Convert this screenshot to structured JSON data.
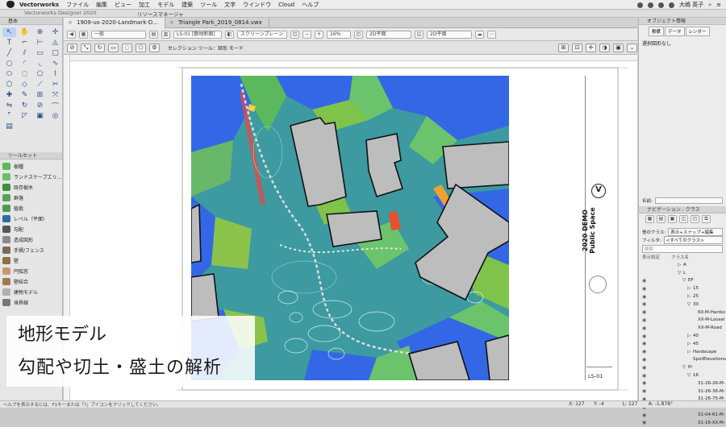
{
  "menubar": {
    "app": "Vectorworks",
    "items": [
      "ファイル",
      "編集",
      "ビュー",
      "加工",
      "モデル",
      "建築",
      "ツール",
      "文字",
      "ウインドウ",
      "Cloud",
      "ヘルプ"
    ],
    "user": "大嶋 英子"
  },
  "titlestrip": {
    "app_title": "Vectorworks Designer 2020",
    "resource_manager": "リソースマネージャ"
  },
  "left_palette": {
    "basic_title": "基本",
    "toolsets_title": "ツールセット",
    "toolsets": [
      {
        "label": "樹種",
        "color": "#5cb85c"
      },
      {
        "label": "ランドスケープエリ…",
        "color": "#6abf69"
      },
      {
        "label": "既存樹木",
        "color": "#3f8f3f"
      },
      {
        "label": "群落",
        "color": "#5aa05a"
      },
      {
        "label": "植栽",
        "color": "#4c9a4c"
      },
      {
        "label": "レベル（平面）",
        "color": "#2e6da4"
      },
      {
        "label": "勾配",
        "color": "#555555"
      },
      {
        "label": "造成図形",
        "color": "#8a8a8a"
      },
      {
        "label": "手摺/フェンス",
        "color": "#7a6a5a"
      },
      {
        "label": "壁",
        "color": "#8b6f47"
      },
      {
        "label": "円弧窓",
        "color": "#c49a6c"
      },
      {
        "label": "壁結合",
        "color": "#a07a50"
      },
      {
        "label": "建物モデル",
        "color": "#b0b0b0"
      },
      {
        "label": "境界線",
        "color": "#777777"
      }
    ]
  },
  "tabs": [
    {
      "label": "1909-us-2020-Landmark-D..."
    },
    {
      "label": "Triangle Park_2019_0814.vwx"
    }
  ],
  "viewbar": {
    "class": "一般",
    "layer": "LS-01 [敷地断面]",
    "render": "スクリーンプレーン",
    "zoom": "16%",
    "view1": "2D平面",
    "view2": "2D平面"
  },
  "modebar": {
    "label": "セレクション ツール：矩形 モード"
  },
  "titleblock": {
    "line1": "2020 DEMO",
    "line2": "Public Space",
    "sheet": "LS-01",
    "logo": "V"
  },
  "caption": {
    "line1": "地形モデル",
    "line2": "勾配や切土・盛土の解析"
  },
  "status": {
    "help": "ヘルプを表示するには、F1キーまたは「?」アイコンをクリックしてください。",
    "x_label": "X:",
    "x_value": "127",
    "y_label": "Y:",
    "y_value": "-4",
    "l_label": "L:",
    "l_value": "127",
    "a_label": "A:",
    "a_value": "-1.878°"
  },
  "right_panel": {
    "obj_info_title": "オブジェクト情報",
    "obj_tabs": [
      "形状",
      "データ",
      "レンダー"
    ],
    "no_selection": "選択図形なし",
    "name_label": "名前:",
    "nav_title": "ナビゲーション - クラス",
    "other_classes_label": "他のクラス:",
    "other_classes_value": "表示+スナップ+編集",
    "filter_label": "フィルタ:",
    "filter_value": "<すべてのクラス>",
    "search_placeholder": "検索",
    "col_visibility": "表示設定",
    "col_class": "クラス名",
    "classes": [
      {
        "label": "A",
        "indent": 1,
        "arrow": "▷"
      },
      {
        "label": "L",
        "indent": 1,
        "arrow": "▽"
      },
      {
        "label": "EF",
        "indent": 2,
        "arrow": "▽"
      },
      {
        "label": "15",
        "indent": 3,
        "arrow": "▷"
      },
      {
        "label": "25",
        "indent": 3,
        "arrow": "▷"
      },
      {
        "label": "30",
        "indent": 3,
        "arrow": "▽"
      },
      {
        "label": "60-M-Hardsc",
        "indent": 4,
        "arrow": ""
      },
      {
        "label": "XX-M-Loosel",
        "indent": 4,
        "arrow": ""
      },
      {
        "label": "XX-M-Road",
        "indent": 4,
        "arrow": ""
      },
      {
        "label": "40",
        "indent": 3,
        "arrow": "▷"
      },
      {
        "label": "45",
        "indent": 3,
        "arrow": "▷"
      },
      {
        "label": "Hardscape",
        "indent": 3,
        "arrow": "▷"
      },
      {
        "label": "SpotElevations",
        "indent": 3,
        "arrow": ""
      },
      {
        "label": "Pr",
        "indent": 2,
        "arrow": "▽"
      },
      {
        "label": "16",
        "indent": 3,
        "arrow": "▽"
      },
      {
        "label": "31-26-26-M-",
        "indent": 4,
        "arrow": ""
      },
      {
        "label": "31-26-36-M-",
        "indent": 4,
        "arrow": ""
      },
      {
        "label": "31-26-75-M-",
        "indent": 4,
        "arrow": ""
      },
      {
        "label": "20",
        "indent": 3,
        "arrow": "▽"
      },
      {
        "label": "31-04-61-M-",
        "indent": 4,
        "arrow": ""
      },
      {
        "label": "31-16-XX-M-",
        "indent": 4,
        "arrow": ""
      }
    ]
  }
}
